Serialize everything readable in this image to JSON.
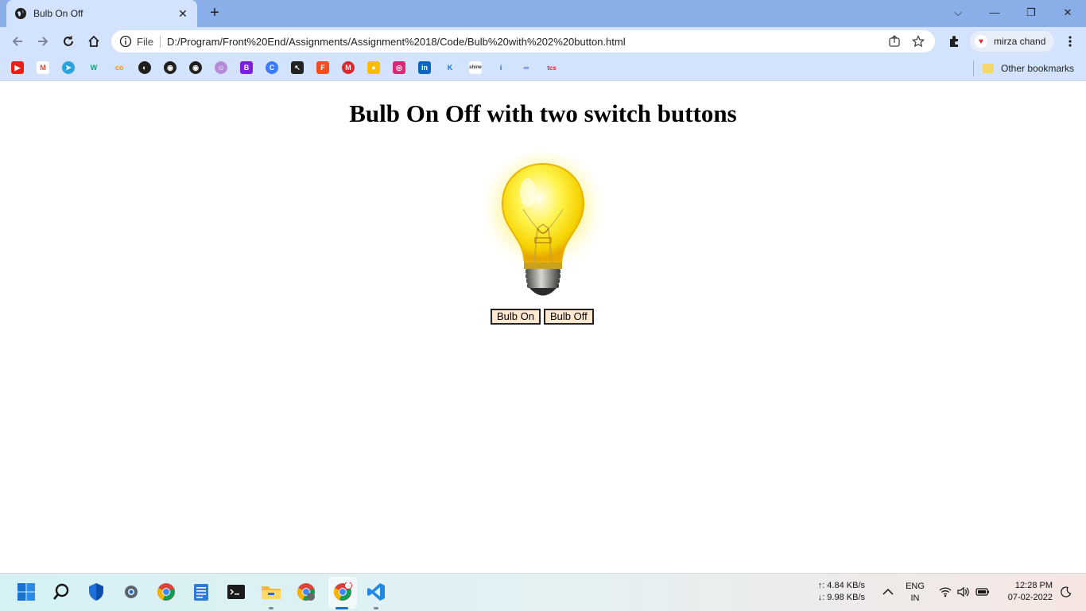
{
  "browser": {
    "tab_title": "Bulb On Off",
    "new_tab_symbol": "+",
    "url_scheme": "File",
    "url": "D:/Program/Front%20End/Assignments/Assignment%2018/Code/Bulb%20with%202%20button.html",
    "profile_name": "mirza chand",
    "other_bookmarks": "Other bookmarks",
    "bookmark_icons": [
      "youtube-icon",
      "gmail-icon",
      "telegram-icon",
      "w3schools-icon",
      "coursera-icon",
      "web-icon",
      "github-icon",
      "github-icon",
      "avatar-icon",
      "bootstrap-icon",
      "codepen-icon",
      "cursor-icon",
      "figma-icon",
      "mega-icon",
      "keep-icon",
      "instagram-icon",
      "linkedin-icon",
      "kotlin-icon",
      "shine-icon",
      "info-icon",
      "link-icon",
      "tcs-icon"
    ]
  },
  "page": {
    "title": "Bulb On Off with two switch buttons",
    "bulb_state": "on",
    "buttons": {
      "on": "Bulb On",
      "off": "Bulb Off"
    }
  },
  "taskbar": {
    "upload_speed": "↑: 4.84 KB/s",
    "download_speed": "↓: 9.98 KB/s",
    "lang_primary": "ENG",
    "lang_secondary": "IN",
    "time": "12:28 PM",
    "date": "07-02-2022"
  },
  "colors": {
    "tab_strip": "#8aaee8",
    "toolbar": "#d3e3fd",
    "button_bg": "#ffe8cf"
  }
}
